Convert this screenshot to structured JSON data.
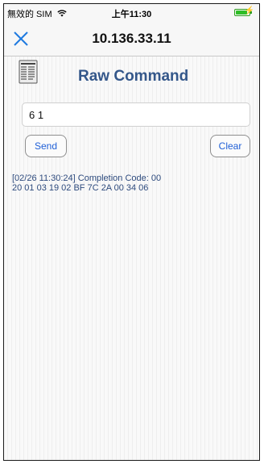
{
  "status_bar": {
    "carrier": "無效的 SIM",
    "time": "上午11:30",
    "battery_level": 0.85,
    "wifi_icon": "wifi-icon",
    "charging_icon": "charging-bolt-icon"
  },
  "nav": {
    "title": "10.136.33.11",
    "close_icon": "close-icon"
  },
  "screen": {
    "title": "Raw Command",
    "icon": "command-document-icon"
  },
  "command_input": {
    "value": "6 1",
    "placeholder": ""
  },
  "buttons": {
    "send_label": "Send",
    "clear_label": "Clear"
  },
  "log": {
    "lines": [
      "[02/26 11:30:24] Completion Code: 00",
      "20 01 03 19 02 BF 7C 2A 00 34 06"
    ]
  },
  "colors": {
    "accent": "#1f5fd6",
    "title": "#34578a",
    "log_text": "#2d4a7d",
    "battery": "#2fbd27"
  }
}
